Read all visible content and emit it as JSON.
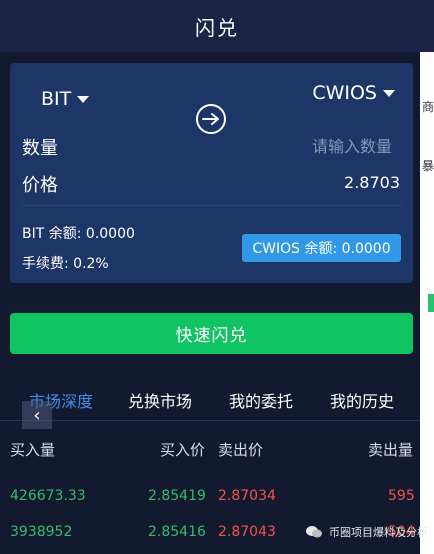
{
  "header": {
    "title": "闪兑"
  },
  "swap": {
    "from_token": "BIT",
    "to_token": "CWIOS",
    "quantity_label": "数量",
    "quantity_placeholder": "请输入数量",
    "price_label": "价格",
    "price_value": "2.8703",
    "from_balance": "BIT 余额: 0.0000",
    "fee": "手续费: 0.2%",
    "to_balance": "CWIOS 余额: 0.0000"
  },
  "quick_swap_label": "快速闪兑",
  "tabs": [
    {
      "label": "市场深度",
      "active": true
    },
    {
      "label": "兑换市场",
      "active": false
    },
    {
      "label": "我的委托",
      "active": false
    },
    {
      "label": "我的历史",
      "active": false
    }
  ],
  "depth": {
    "headers": [
      "买入量",
      "买入价",
      "卖出价",
      "卖出量"
    ],
    "rows": [
      [
        "426673.33",
        "2.85419",
        "2.87034",
        "595"
      ],
      [
        "3938952",
        "2.85416",
        "2.87043",
        "504"
      ]
    ]
  },
  "right_strip": [
    "商",
    "暴"
  ],
  "watermark": "币圈项目爆料及分析",
  "colors": {
    "buy": "#2fbf6a",
    "sell": "#f0534a",
    "accent": "#3b8ef0",
    "button": "#11c463"
  }
}
